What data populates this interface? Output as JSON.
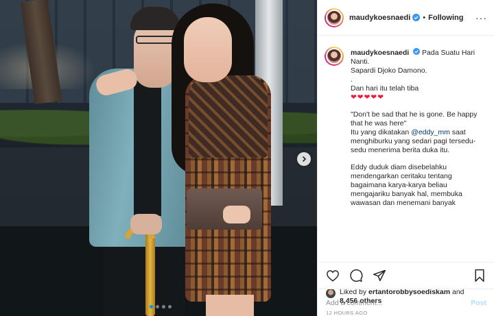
{
  "header": {
    "username": "maudykoesnaedi",
    "separator": "•",
    "follow_status": "Following",
    "more": "···"
  },
  "caption": {
    "username": "maudykoesnaedi",
    "lines": [
      "Pada Suatu Hari Nanti.",
      "Sapardi Djoko Damono.",
      ".",
      "Dan hari itu telah tiba"
    ],
    "hearts": "❤❤❤❤❤",
    "quote": "\"Don't be sad that he is gone. Be happy that he was here\"",
    "said_prefix": "Itu yang dikatakan ",
    "mention": "@eddy_mm",
    "said_suffix": " saat menghiburku yang sedari pagi tersedu-sedu menerima berita duka itu.",
    "paragraph2": "Eddy duduk diam disebelahku mendengarkan ceritaku tentang bagaimana karya-karya beliau mengajariku banyak hal, membuka wawasan dan menemani banyak"
  },
  "likes": {
    "prefix": "Liked by ",
    "user": "ertantorobbysoediskam",
    "and": " and",
    "others": "8,456 others"
  },
  "timestamp": "12 HOURS AGO",
  "comment": {
    "placeholder": "Add a comment...",
    "post_label": "Post"
  },
  "carousel": {
    "count": 4,
    "active_index": 0
  },
  "colors": {
    "verified": "#3897f0",
    "link": "#00376b",
    "active_dot": "#0095f6",
    "post_disabled": "#b2dffc",
    "muted": "#8e8e8e"
  }
}
